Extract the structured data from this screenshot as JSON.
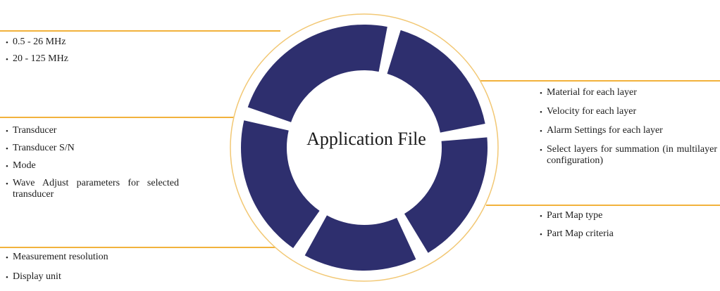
{
  "center": {
    "title": "Application File"
  },
  "groups": {
    "frequency": {
      "items": [
        "0.5 - 26 MHz",
        "20 - 125 MHz"
      ]
    },
    "transducer": {
      "items": [
        "Transducer",
        "Transducer S/N",
        "Mode",
        "Wave Adjust parameters for selected transducer"
      ]
    },
    "display": {
      "items": [
        "Measurement resolution",
        "Display unit"
      ]
    },
    "layers": {
      "items": [
        "Material for each layer",
        "Velocity for each layer",
        "Alarm Settings for each layer",
        "Select layers for summation (in multilayer configuration)"
      ]
    },
    "partmap": {
      "items": [
        "Part Map type",
        "Part Map criteria"
      ]
    }
  },
  "colors": {
    "ring": "#2e2f6e",
    "accent_line": "#f2b23c",
    "outer_circle": "#f2c875",
    "text": "#1c1c1c"
  }
}
